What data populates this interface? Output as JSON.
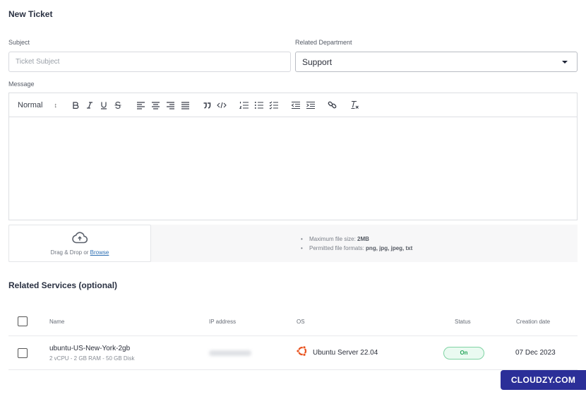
{
  "page": {
    "title": "New Ticket"
  },
  "form": {
    "subject": {
      "label": "Subject",
      "placeholder": "Ticket Subject",
      "value": ""
    },
    "department": {
      "label": "Related Department",
      "selected": "Support"
    },
    "message": {
      "label": "Message",
      "toolbar": {
        "heading_select": "Normal",
        "buttons": [
          "bold",
          "italic",
          "underline",
          "strike",
          "align-left",
          "align-center",
          "align-right",
          "align-justify",
          "blockquote",
          "code-block",
          "ordered-list",
          "bullet-list",
          "check-list",
          "outdent",
          "indent",
          "link",
          "clear-format"
        ]
      },
      "value": ""
    },
    "upload": {
      "drop_text": "Drag & Drop or",
      "browse_label": "Browse",
      "max_size_label": "Maximum file size:",
      "max_size_value": "2MB",
      "formats_label": "Permitted file formats:",
      "formats_value": "png, jpg, jpeg, txt"
    }
  },
  "services": {
    "title": "Related Services (optional)",
    "columns": {
      "name": "Name",
      "ip": "IP address",
      "os": "OS",
      "status": "Status",
      "created": "Creation date"
    },
    "rows": [
      {
        "name": "ubuntu-US-New-York-2gb",
        "spec": "2 vCPU - 2 GB RAM - 50 GB Disk",
        "ip": "(blurred)",
        "os": "Ubuntu Server 22.04",
        "os_icon": "ubuntu-icon",
        "status": "On",
        "created": "07 Dec 2023",
        "checked": false
      }
    ]
  },
  "brand": {
    "label": "CLOUDZY.COM",
    "color": "#2b2f98"
  },
  "colors": {
    "status_on": "#25a55a",
    "link": "#2d6fb3",
    "ubuntu": "#e95420"
  }
}
